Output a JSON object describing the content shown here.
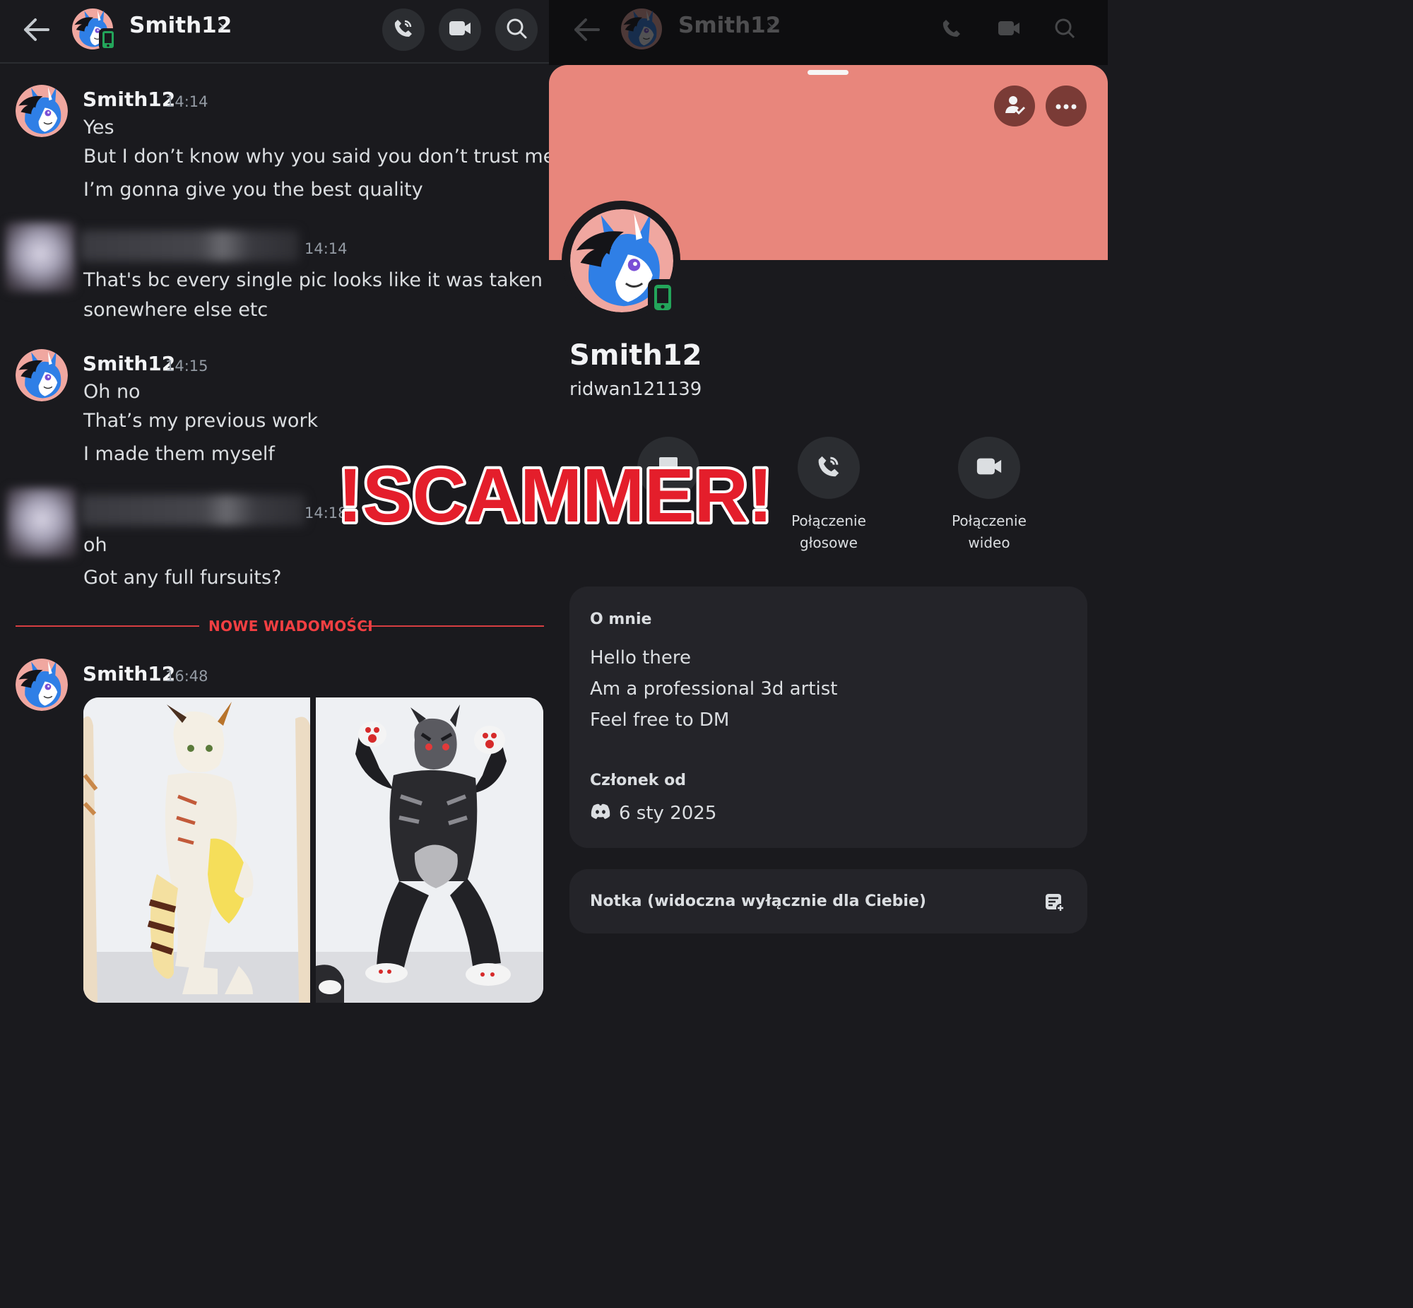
{
  "left": {
    "header": {
      "name": "Smith12",
      "chevron": "›"
    },
    "messages": [
      {
        "author": "Smith12",
        "time": "14:14",
        "lines": [
          "Yes",
          "But I don’t know why you said you don’t trust me",
          "I’m gonna give you the best quality"
        ]
      },
      {
        "author": "",
        "time": "14:14",
        "lines": [
          "That's bc every single pic looks like it was taken",
          "sonewhere else etc"
        ]
      },
      {
        "author": "Smith12",
        "time": "14:15",
        "lines": [
          "Oh no",
          "That’s my previous work",
          "I made them myself"
        ]
      },
      {
        "author": "",
        "time": "14:18",
        "lines": [
          "oh",
          "Got any full fursuits?"
        ]
      },
      {
        "author": "Smith12",
        "time": "16:48",
        "lines": []
      }
    ],
    "new_messages_label": "NOWE WIADOMOŚCI"
  },
  "right": {
    "header": {
      "name": "Smith12",
      "chevron": "›"
    },
    "profile": {
      "display_name": "Smith12",
      "username": "ridwan121139"
    },
    "actions": [
      {
        "label": "Połączenie głosowe"
      },
      {
        "label": "Połączenie wideo"
      }
    ],
    "about": {
      "heading": "O mnie",
      "lines": [
        "Hello there",
        "Am a professional 3d artist",
        "Feel free to DM"
      ],
      "member_heading": "Członek od",
      "member_since": "6 sty 2025"
    },
    "note": {
      "label": "Notka (widoczna wyłącznie dla Ciebie)"
    }
  },
  "overlay": {
    "text": "!SCAMMER!"
  },
  "colors": {
    "banner": "#e8867c",
    "accent_red": "#f23f42",
    "online_green": "#23a55a",
    "scam_red": "#e41e2b"
  }
}
